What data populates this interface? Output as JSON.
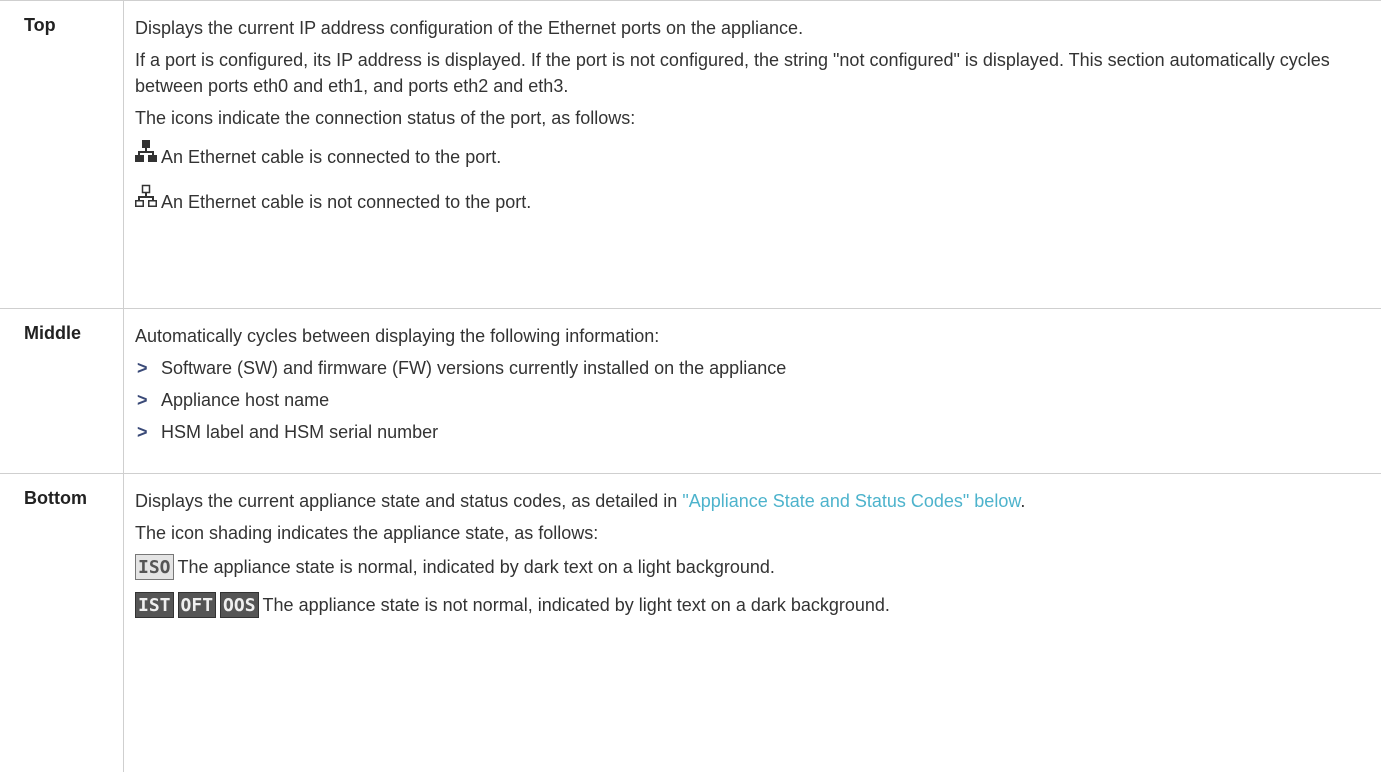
{
  "rows": {
    "top": {
      "header": "Top",
      "p1": "Displays the current IP address configuration of the Ethernet ports on the appliance.",
      "p2": "If a port is configured, its IP address is displayed. If the port is not configured, the string \"not configured\" is displayed. This section automatically cycles between ports eth0 and eth1, and ports eth2 and eth3.",
      "p3": "The icons indicate the connection status of the port, as follows:",
      "icon_connected": {
        "icon": "network-connected-icon",
        "text": "An Ethernet cable is connected to the port."
      },
      "icon_disconnected": {
        "icon": "network-disconnected-icon",
        "text": "An Ethernet cable is not connected to the port."
      }
    },
    "middle": {
      "header": "Middle",
      "p1": "Automatically cycles between displaying the following information:",
      "bullet_marker": ">",
      "bullets": [
        "Software (SW) and firmware (FW) versions currently installed on the appliance",
        "Appliance host name",
        "HSM label and HSM serial number"
      ]
    },
    "bottom": {
      "header": "Bottom",
      "p1_before": "Displays the current appliance state and status codes, as detailed in ",
      "p1_link": "\"Appliance State and Status Codes\" below",
      "p1_after": ".",
      "p2": "The icon shading indicates the appliance state, as follows:",
      "normal": {
        "codes": [
          "ISO"
        ],
        "text": "The appliance state is normal, indicated by dark text on a light background."
      },
      "abnormal": {
        "codes": [
          "IST",
          "OFT",
          "OOS"
        ],
        "text": "The appliance state is not normal, indicated by light text on a dark background."
      }
    }
  },
  "colors": {
    "link": "#4db3cc",
    "bullet": "#3a4a78",
    "border": "#cfcfcf"
  }
}
